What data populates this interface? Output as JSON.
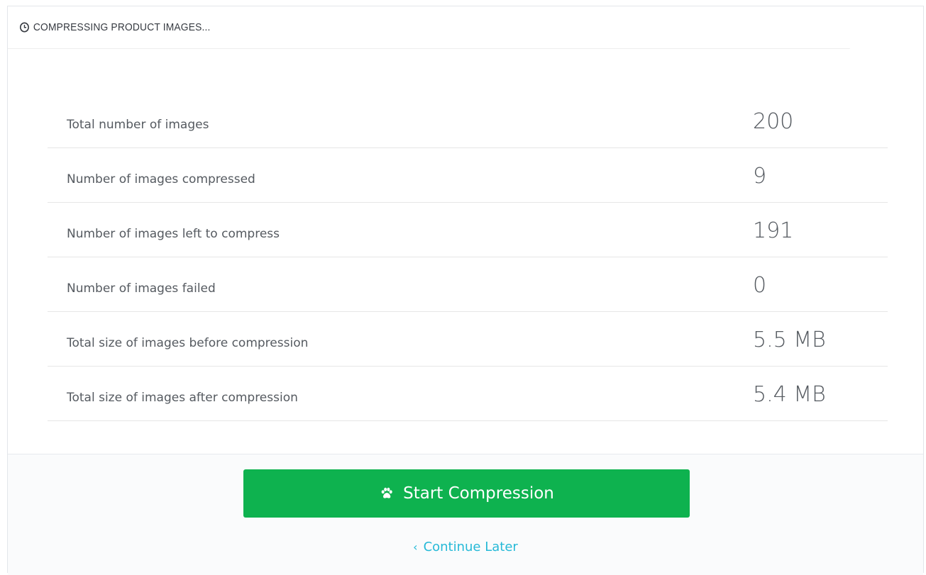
{
  "panel": {
    "title": "COMPRESSING PRODUCT IMAGES...",
    "title_icon": "clock-icon"
  },
  "stats": [
    {
      "label": "Total number of images",
      "value": "200"
    },
    {
      "label": "Number of images compressed",
      "value": "9"
    },
    {
      "label": "Number of images left to compress",
      "value": "191"
    },
    {
      "label": "Number of images failed",
      "value": "0"
    },
    {
      "label": "Total size of images before compression",
      "value": "5.5 MB"
    },
    {
      "label": "Total size of images after compression",
      "value": "5.4 MB"
    }
  ],
  "footer": {
    "start_label": "Start Compression",
    "start_icon": "paw-icon",
    "continue_label": "Continue Later",
    "continue_icon": "chevron-left-icon"
  },
  "colors": {
    "primary_button": "#0eb24f",
    "link": "#25b9d7",
    "text": "#555a60"
  }
}
